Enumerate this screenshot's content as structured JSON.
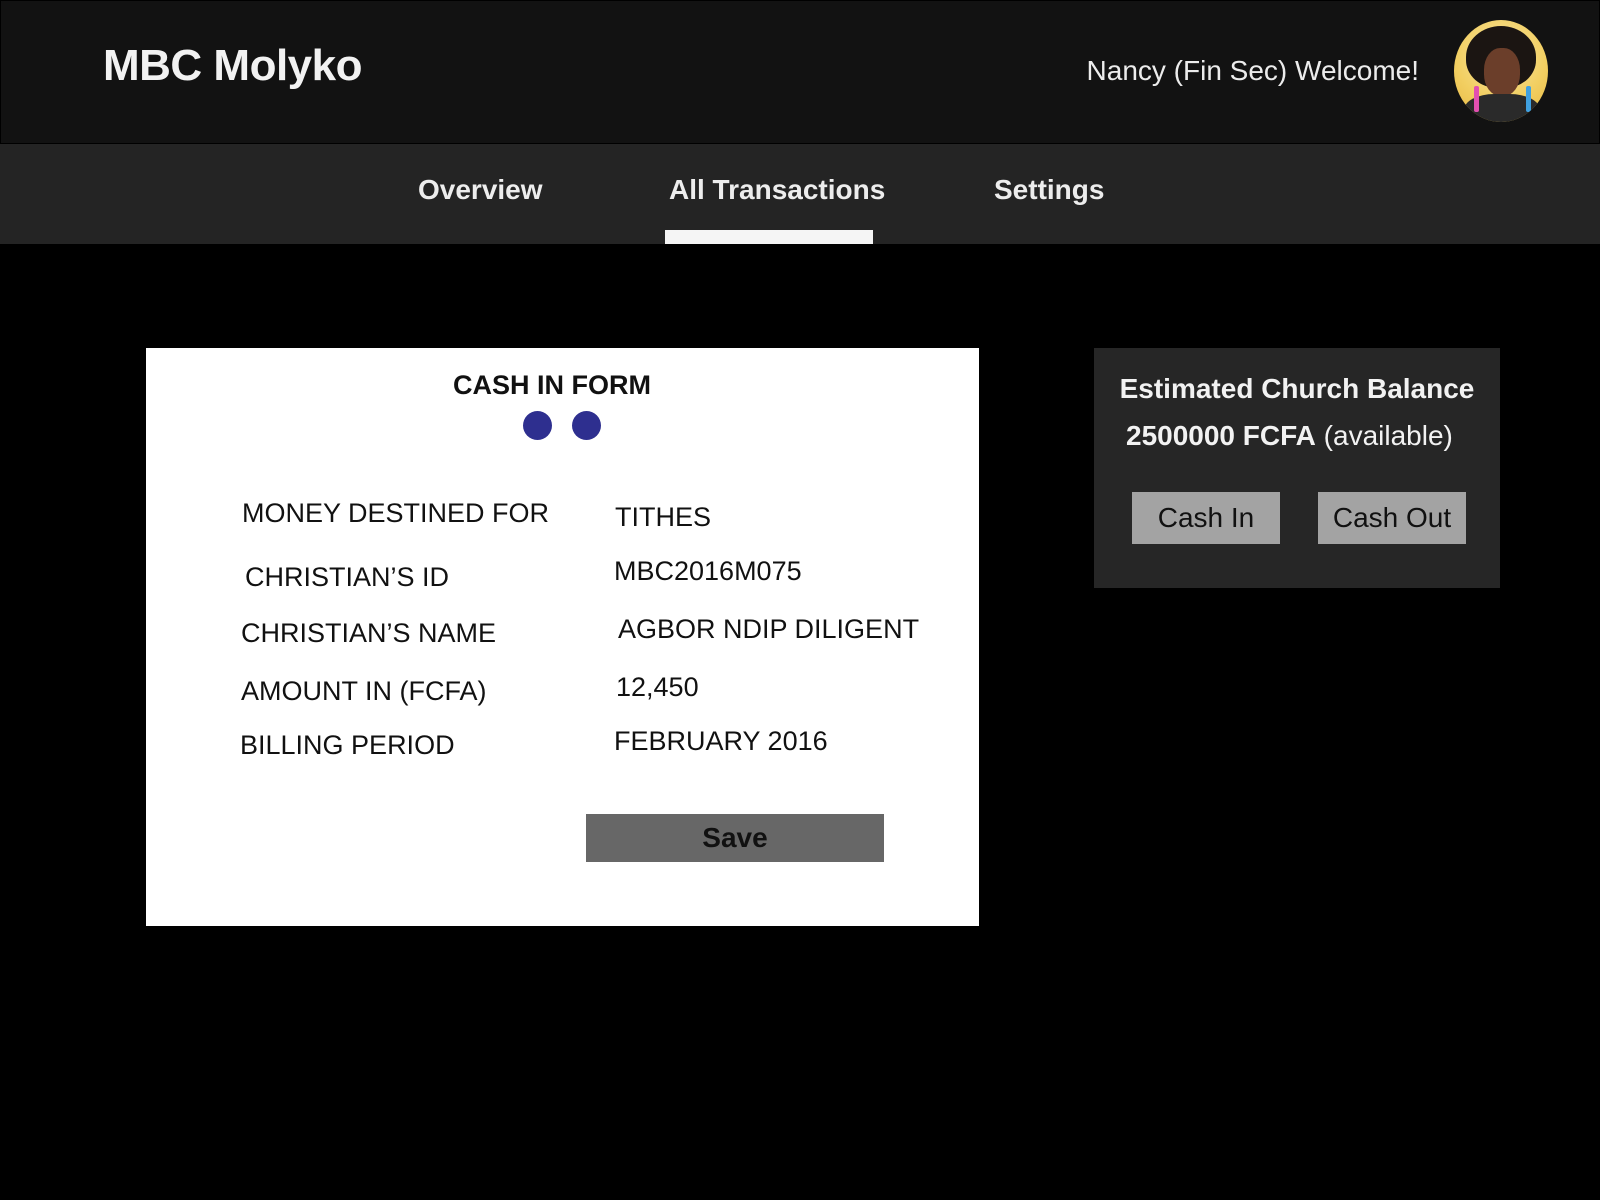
{
  "header": {
    "brand": "MBC Molyko",
    "welcome_text": "Nancy (Fin Sec) Welcome!",
    "avatar": "user-avatar"
  },
  "nav": {
    "tabs": [
      {
        "label": "Overview",
        "active": false
      },
      {
        "label": "All Transactions",
        "active": true
      },
      {
        "label": "Settings",
        "active": false
      }
    ]
  },
  "form": {
    "title": "CASH IN FORM",
    "step_dot_color": "#2e2f8f",
    "fields": [
      {
        "label": "MONEY DESTINED FOR",
        "value": "TITHES"
      },
      {
        "label": "CHRISTIAN’S ID",
        "value": "MBC2016M075"
      },
      {
        "label": "CHRISTIAN’S NAME",
        "value": "AGBOR NDIP DILIGENT"
      },
      {
        "label": "AMOUNT IN (FCFA)",
        "value": "12,450"
      },
      {
        "label": "BILLING PERIOD",
        "value": "FEBRUARY 2016"
      }
    ],
    "save_label": "Save"
  },
  "balance": {
    "title": "Estimated Church Balance",
    "amount": "2500000 FCFA",
    "status": "(available)",
    "cash_in_label": "Cash In",
    "cash_out_label": "Cash Out"
  }
}
